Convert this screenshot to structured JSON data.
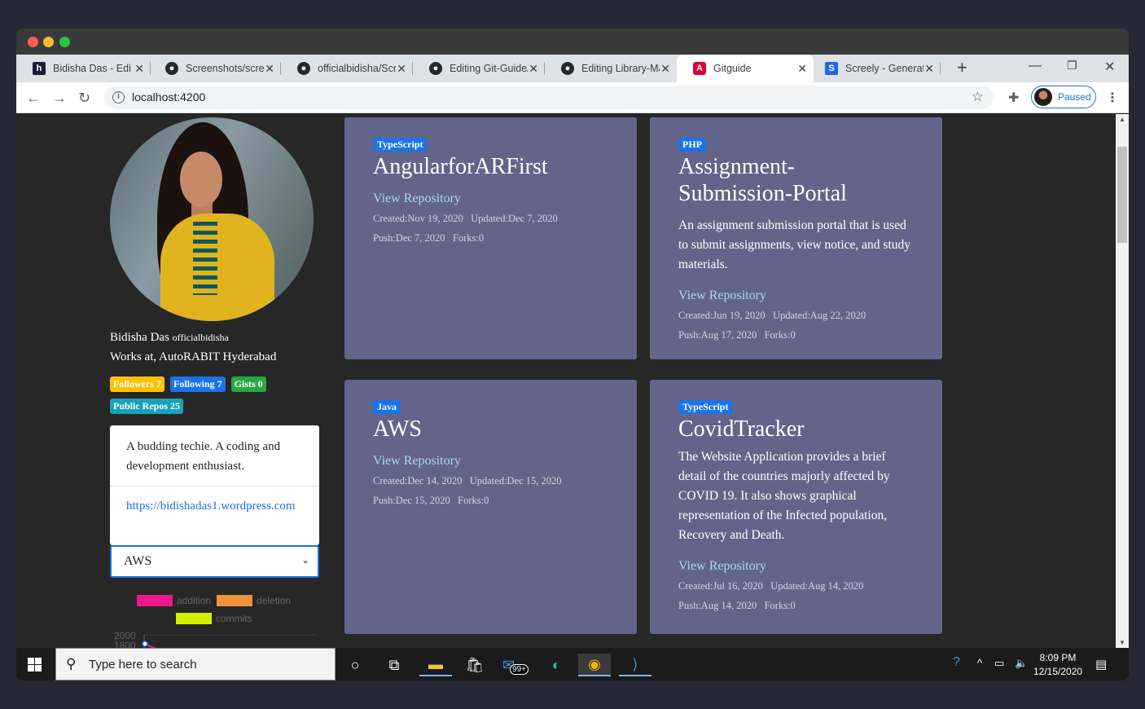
{
  "browser": {
    "tabs": [
      {
        "label": "Bidisha Das - Edit",
        "favicon": "h-icon"
      },
      {
        "label": "Screenshots/scree",
        "favicon": "github-icon"
      },
      {
        "label": "officialbidisha/Scre",
        "favicon": "github-icon"
      },
      {
        "label": "Editing Git-Guide/",
        "favicon": "github-icon"
      },
      {
        "label": "Editing Library-Ma",
        "favicon": "github-icon"
      },
      {
        "label": "Gitguide",
        "favicon": "angular-icon",
        "active": true
      },
      {
        "label": "Screely - Generate",
        "favicon": "s-icon"
      }
    ],
    "url": "localhost:4200",
    "profile_status": "Paused"
  },
  "profile": {
    "name": "Bidisha Das",
    "login": "officialbidisha",
    "work": "Works at, AutoRABIT Hyderabad",
    "badges": {
      "followers": "Followers 7",
      "following": "Following 7",
      "gists": "Gists 0",
      "public_repos": "Public Repos 25"
    },
    "bio": "A budding techie. A coding and development enthusiast.",
    "blog": "https://bidishadas1.wordpress.com",
    "selected_repo": "AWS"
  },
  "chart": {
    "legend": [
      "addition",
      "deletion",
      "commits"
    ],
    "y_ticks": [
      "2000",
      "1800"
    ]
  },
  "repos": [
    {
      "language": "TypeScript",
      "name": "AngularforARFirst",
      "description": "",
      "link": "View Repository",
      "created": "Created:Nov 19, 2020",
      "updated": "Updated:Dec 7, 2020",
      "push": "Push:Dec 7, 2020",
      "forks": "Forks:0"
    },
    {
      "language": "PHP",
      "name": "Assignment-Submission-Portal",
      "description": "An assignment submission portal that is used to submit assignments, view notice, and study materials.",
      "link": "View Repository",
      "created": "Created:Jun 19, 2020",
      "updated": "Updated:Aug 22, 2020",
      "push": "Push:Aug 17, 2020",
      "forks": "Forks:0"
    },
    {
      "language": "Java",
      "name": "AWS",
      "description": "",
      "link": "View Repository",
      "created": "Created:Dec 14, 2020",
      "updated": "Updated:Dec 15, 2020",
      "push": "Push:Dec 15, 2020",
      "forks": "Forks:0"
    },
    {
      "language": "TypeScript",
      "name": "CovidTracker",
      "description": "The Website Application provides a brief detail of the countries majorly affected by COVID 19. It also shows graphical representation of the Infected population, Recovery and Death.",
      "link": "View Repository",
      "created": "Created:Jul 16, 2020",
      "updated": "Updated:Aug 14, 2020",
      "push": "Push:Aug 14, 2020",
      "forks": "Forks:0"
    }
  ],
  "taskbar": {
    "search_placeholder": "Type here to search",
    "mail_badge": "99+",
    "time": "8:09 PM",
    "date": "12/15/2020"
  },
  "colors": {
    "addition": "#f0168e",
    "deletion": "#f0923a",
    "commits": "#d4f000"
  }
}
